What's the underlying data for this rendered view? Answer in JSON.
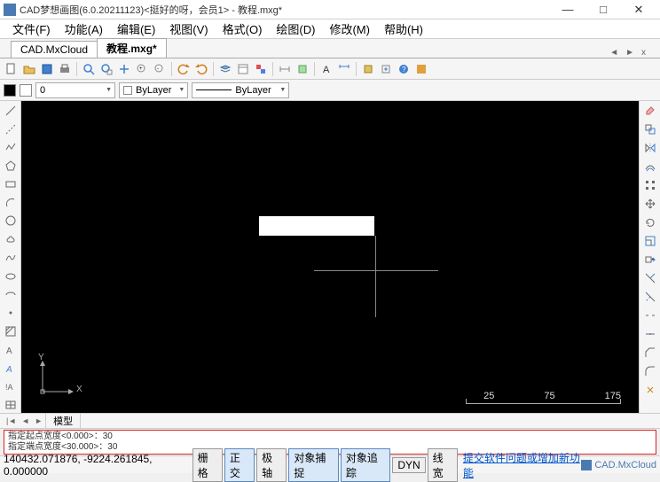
{
  "window": {
    "title": "CAD梦想画图(6.0.20211123)<挺好的呀，会员1> - 教程.mxg*",
    "min": "—",
    "max": "□",
    "close": "✕"
  },
  "menu": {
    "file": "文件(F)",
    "func": "功能(A)",
    "edit": "编辑(E)",
    "view": "视图(V)",
    "format": "格式(O)",
    "draw": "绘图(D)",
    "modify": "修改(M)",
    "help": "帮助(H)"
  },
  "tabs": {
    "t1": "CAD.MxCloud",
    "t2": "教程.mxg*"
  },
  "props": {
    "layer0": "0",
    "bylayer1": "ByLayer",
    "bylayer2": "ByLayer"
  },
  "scale": {
    "a": "25",
    "b": "75",
    "c": "175"
  },
  "bottomtab": {
    "model": "模型"
  },
  "cmd": {
    "l1": "指定起点宽度<0.000>：30",
    "l2": "指定端点宽度<30.000>：30"
  },
  "status": {
    "coords": "140432.071876, -9224.261845, 0.000000",
    "grid": "栅格",
    "ortho": "正交",
    "polar": "极轴",
    "osnap": "对象捕捉",
    "otrack": "对象追踪",
    "dyn": "DYN",
    "lw": "线宽",
    "link": "提交软件问题或增加新功能",
    "brand": "CAD.MxCloud"
  },
  "ucs": {
    "x": "X",
    "y": "Y"
  }
}
